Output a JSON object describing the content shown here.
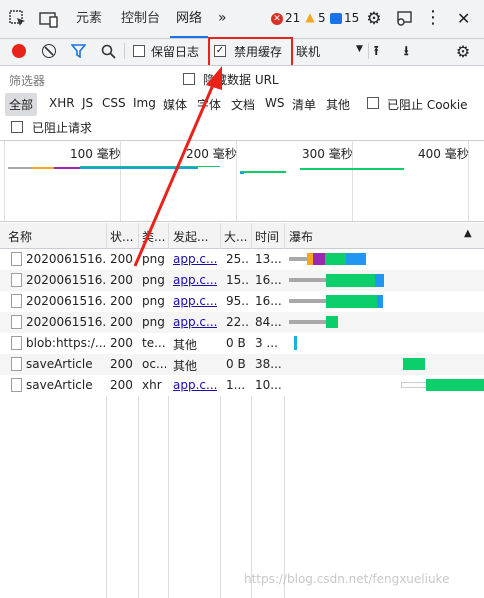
{
  "tabs": {
    "items": [
      "元素",
      "控制台",
      "网络"
    ],
    "errors": "21",
    "warnings": "5",
    "messages": "15"
  },
  "toolbar": {
    "preserve_log": "保留日志",
    "disable_cache": "禁用缓存",
    "throttle": "联机"
  },
  "filter": {
    "placeholder": "筛选器",
    "hide_data_url": "隐藏数据 URL",
    "types": [
      "全部",
      "XHR",
      "JS",
      "CSS",
      "Img",
      "媒体",
      "字体",
      "文档",
      "WS",
      "清单",
      "其他"
    ],
    "blocked_cookies": "已阻止 Cookie",
    "blocked_requests": "已阻止请求"
  },
  "overview": {
    "ticks": [
      "100 毫秒",
      "200 毫秒",
      "300 毫秒",
      "400 毫秒"
    ]
  },
  "table": {
    "headers": [
      "名称",
      "状...",
      "类...",
      "发起...",
      "大...",
      "时间",
      "瀑布"
    ],
    "rows": [
      [
        "2020061516...",
        "200",
        "png",
        "app.c...",
        "25...",
        "13..."
      ],
      [
        "2020061516...",
        "200",
        "png",
        "app.c...",
        "15...",
        "16..."
      ],
      [
        "2020061516...",
        "200",
        "png",
        "app.c...",
        "95...",
        "16..."
      ],
      [
        "2020061516...",
        "200",
        "png",
        "app.c...",
        "22...",
        "84..."
      ],
      [
        "blob:https:/...",
        "200",
        "te...",
        "其他",
        "0 B",
        "3 ..."
      ],
      [
        "saveArticle",
        "200",
        "oc...",
        "其他",
        "0 B",
        "38..."
      ],
      [
        "saveArticle",
        "200",
        "xhr",
        "app.c...",
        "1...",
        "10..."
      ]
    ]
  },
  "watermark": "https://blog.csdn.net/fengxueliuke",
  "colors": {
    "accent": "#1a73e8",
    "annotation_red": "#e8231c",
    "bar_green": "#0cce6b",
    "bar_blue": "#2196f3",
    "bar_gray": "#a8a8a8"
  }
}
